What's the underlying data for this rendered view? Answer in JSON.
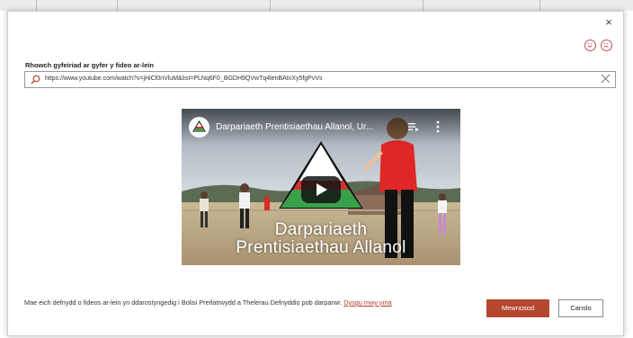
{
  "dialog": {
    "close_glyph": "×",
    "feedback_icons": [
      "smile-icon",
      "frown-icon"
    ],
    "field_label": "Rhowch gyfeiriad ar gyfer y fideo ar-lein",
    "url_value": "https://www.youtube.com/watch?v=jHiCl0nVluM&list=PLNq6F0_BGDH9QVwTq4lenBAtvXy5fgPvVs",
    "url_clear_glyph": "╳"
  },
  "video": {
    "title": "Darpariaeth Prentisiaethau Allanol, Ur...",
    "overlay_line1": "Darpariaeth",
    "overlay_line2": "Prentisiaethau Allanol"
  },
  "footer": {
    "notice": "Mae eich defnydd o fideos ar-lein yn ddarostyngedig i Bolisi Preifatrwydd a Thelerau Defnyddio pob darparwr.",
    "learn_more": "Dysgu mwy yma",
    "insert_label": "Mewnosod",
    "cancel_label": "Canslo"
  },
  "colors": {
    "accent": "#b5472f",
    "link": "#b43b2b",
    "logo_red": "#d2312c",
    "logo_green": "#3aa14a"
  }
}
